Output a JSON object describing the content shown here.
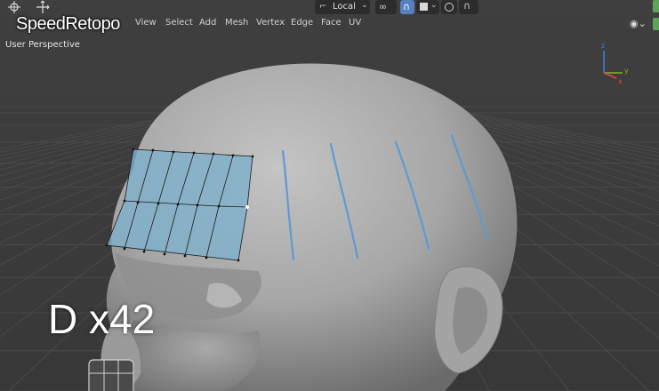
{
  "overlay": {
    "title": "SpeedRetopo",
    "key_count": "D x42"
  },
  "viewport": {
    "view_label": "User Perspective"
  },
  "header_menu": [
    "View",
    "Select",
    "Add",
    "Mesh",
    "Vertex",
    "Edge",
    "Face",
    "UV"
  ],
  "top_toolbar": {
    "transform_orientation": "Local"
  },
  "gizmo": {
    "x_label": "x",
    "y_label": "y",
    "z_label": "z"
  },
  "colors": {
    "viewport_bg": "#3d3d3d",
    "mesh": "#a8a8a8",
    "retopo_face": "#7fb0cc",
    "stroke": "#5f9ad1",
    "gizmo_x": "#e0444f",
    "gizmo_y": "#84b324",
    "gizmo_z": "#3b7ee0"
  },
  "icons": [
    "cursor-tool-icon",
    "move-tool-icon",
    "chevron-down-icon",
    "link-icon",
    "magnet-icon",
    "proportional-edit-icon",
    "falloff-curve-icon",
    "visibility-icon",
    "overlay-toggle-icon"
  ]
}
